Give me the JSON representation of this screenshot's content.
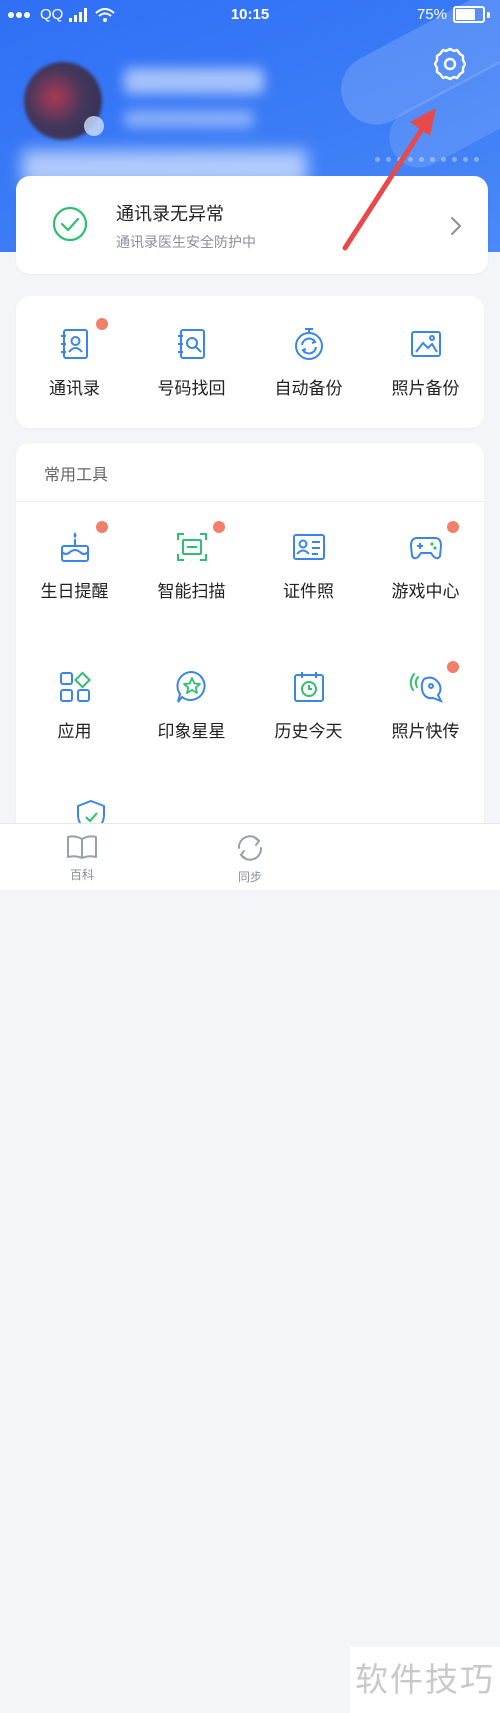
{
  "status_bar": {
    "carrier": "QQ",
    "time": "10:15",
    "battery": "75%"
  },
  "status_card": {
    "title": "通讯录无异常",
    "subtitle": "通讯录医生安全防护中"
  },
  "features": [
    {
      "label": "通讯录",
      "icon": "contacts-icon",
      "badge": true
    },
    {
      "label": "号码找回",
      "icon": "number-recovery-icon",
      "badge": false
    },
    {
      "label": "自动备份",
      "icon": "auto-backup-icon",
      "badge": false
    },
    {
      "label": "照片备份",
      "icon": "photo-backup-icon",
      "badge": false
    }
  ],
  "tools": {
    "title": "常用工具",
    "items": [
      {
        "label": "生日提醒",
        "icon": "birthday-cake-icon",
        "badge": true
      },
      {
        "label": "智能扫描",
        "icon": "scan-icon",
        "badge": true
      },
      {
        "label": "证件照",
        "icon": "id-photo-icon",
        "badge": false
      },
      {
        "label": "游戏中心",
        "icon": "gamepad-icon",
        "badge": true
      },
      {
        "label": "应用",
        "icon": "apps-icon",
        "badge": false
      },
      {
        "label": "印象星星",
        "icon": "star-bubble-icon",
        "badge": false
      },
      {
        "label": "历史今天",
        "icon": "history-calendar-icon",
        "badge": false
      },
      {
        "label": "照片快传",
        "icon": "photo-transfer-icon",
        "badge": true
      }
    ]
  },
  "tabbar": [
    {
      "label": "百科",
      "icon": "book-icon"
    },
    {
      "label": "同步",
      "icon": "sync-icon"
    }
  ],
  "watermark": "软件技巧",
  "colors": {
    "brand": "#3476f5",
    "icon_stroke": "#3a86e8",
    "icon_green": "#2fbf71",
    "badge": "#f0806a",
    "annotation_arrow": "#e64a4a"
  }
}
